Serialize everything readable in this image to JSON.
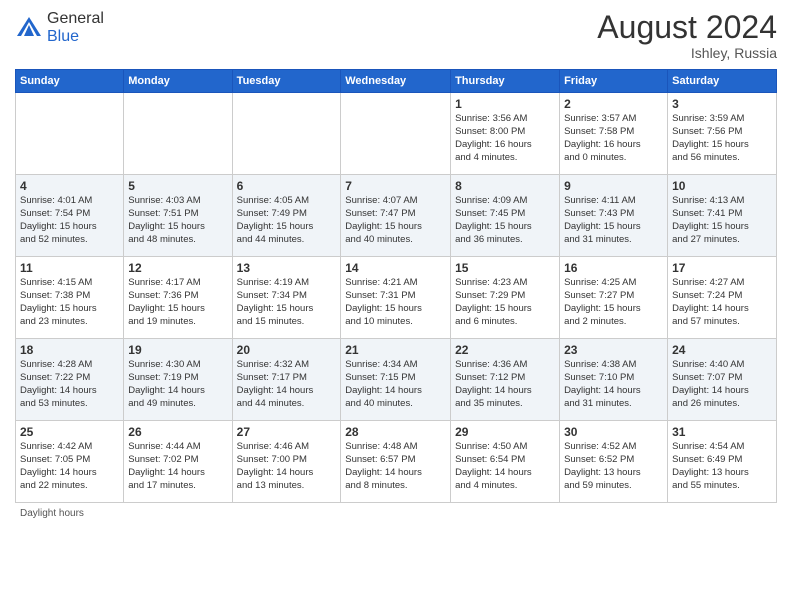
{
  "header": {
    "logo_general": "General",
    "logo_blue": "Blue",
    "month_year": "August 2024",
    "location": "Ishley, Russia"
  },
  "days_of_week": [
    "Sunday",
    "Monday",
    "Tuesday",
    "Wednesday",
    "Thursday",
    "Friday",
    "Saturday"
  ],
  "footer": {
    "daylight_hours_label": "Daylight hours"
  },
  "weeks": [
    [
      {
        "num": "",
        "info": ""
      },
      {
        "num": "",
        "info": ""
      },
      {
        "num": "",
        "info": ""
      },
      {
        "num": "",
        "info": ""
      },
      {
        "num": "1",
        "info": "Sunrise: 3:56 AM\nSunset: 8:00 PM\nDaylight: 16 hours\nand 4 minutes."
      },
      {
        "num": "2",
        "info": "Sunrise: 3:57 AM\nSunset: 7:58 PM\nDaylight: 16 hours\nand 0 minutes."
      },
      {
        "num": "3",
        "info": "Sunrise: 3:59 AM\nSunset: 7:56 PM\nDaylight: 15 hours\nand 56 minutes."
      }
    ],
    [
      {
        "num": "4",
        "info": "Sunrise: 4:01 AM\nSunset: 7:54 PM\nDaylight: 15 hours\nand 52 minutes."
      },
      {
        "num": "5",
        "info": "Sunrise: 4:03 AM\nSunset: 7:51 PM\nDaylight: 15 hours\nand 48 minutes."
      },
      {
        "num": "6",
        "info": "Sunrise: 4:05 AM\nSunset: 7:49 PM\nDaylight: 15 hours\nand 44 minutes."
      },
      {
        "num": "7",
        "info": "Sunrise: 4:07 AM\nSunset: 7:47 PM\nDaylight: 15 hours\nand 40 minutes."
      },
      {
        "num": "8",
        "info": "Sunrise: 4:09 AM\nSunset: 7:45 PM\nDaylight: 15 hours\nand 36 minutes."
      },
      {
        "num": "9",
        "info": "Sunrise: 4:11 AM\nSunset: 7:43 PM\nDaylight: 15 hours\nand 31 minutes."
      },
      {
        "num": "10",
        "info": "Sunrise: 4:13 AM\nSunset: 7:41 PM\nDaylight: 15 hours\nand 27 minutes."
      }
    ],
    [
      {
        "num": "11",
        "info": "Sunrise: 4:15 AM\nSunset: 7:38 PM\nDaylight: 15 hours\nand 23 minutes."
      },
      {
        "num": "12",
        "info": "Sunrise: 4:17 AM\nSunset: 7:36 PM\nDaylight: 15 hours\nand 19 minutes."
      },
      {
        "num": "13",
        "info": "Sunrise: 4:19 AM\nSunset: 7:34 PM\nDaylight: 15 hours\nand 15 minutes."
      },
      {
        "num": "14",
        "info": "Sunrise: 4:21 AM\nSunset: 7:31 PM\nDaylight: 15 hours\nand 10 minutes."
      },
      {
        "num": "15",
        "info": "Sunrise: 4:23 AM\nSunset: 7:29 PM\nDaylight: 15 hours\nand 6 minutes."
      },
      {
        "num": "16",
        "info": "Sunrise: 4:25 AM\nSunset: 7:27 PM\nDaylight: 15 hours\nand 2 minutes."
      },
      {
        "num": "17",
        "info": "Sunrise: 4:27 AM\nSunset: 7:24 PM\nDaylight: 14 hours\nand 57 minutes."
      }
    ],
    [
      {
        "num": "18",
        "info": "Sunrise: 4:28 AM\nSunset: 7:22 PM\nDaylight: 14 hours\nand 53 minutes."
      },
      {
        "num": "19",
        "info": "Sunrise: 4:30 AM\nSunset: 7:19 PM\nDaylight: 14 hours\nand 49 minutes."
      },
      {
        "num": "20",
        "info": "Sunrise: 4:32 AM\nSunset: 7:17 PM\nDaylight: 14 hours\nand 44 minutes."
      },
      {
        "num": "21",
        "info": "Sunrise: 4:34 AM\nSunset: 7:15 PM\nDaylight: 14 hours\nand 40 minutes."
      },
      {
        "num": "22",
        "info": "Sunrise: 4:36 AM\nSunset: 7:12 PM\nDaylight: 14 hours\nand 35 minutes."
      },
      {
        "num": "23",
        "info": "Sunrise: 4:38 AM\nSunset: 7:10 PM\nDaylight: 14 hours\nand 31 minutes."
      },
      {
        "num": "24",
        "info": "Sunrise: 4:40 AM\nSunset: 7:07 PM\nDaylight: 14 hours\nand 26 minutes."
      }
    ],
    [
      {
        "num": "25",
        "info": "Sunrise: 4:42 AM\nSunset: 7:05 PM\nDaylight: 14 hours\nand 22 minutes."
      },
      {
        "num": "26",
        "info": "Sunrise: 4:44 AM\nSunset: 7:02 PM\nDaylight: 14 hours\nand 17 minutes."
      },
      {
        "num": "27",
        "info": "Sunrise: 4:46 AM\nSunset: 7:00 PM\nDaylight: 14 hours\nand 13 minutes."
      },
      {
        "num": "28",
        "info": "Sunrise: 4:48 AM\nSunset: 6:57 PM\nDaylight: 14 hours\nand 8 minutes."
      },
      {
        "num": "29",
        "info": "Sunrise: 4:50 AM\nSunset: 6:54 PM\nDaylight: 14 hours\nand 4 minutes."
      },
      {
        "num": "30",
        "info": "Sunrise: 4:52 AM\nSunset: 6:52 PM\nDaylight: 13 hours\nand 59 minutes."
      },
      {
        "num": "31",
        "info": "Sunrise: 4:54 AM\nSunset: 6:49 PM\nDaylight: 13 hours\nand 55 minutes."
      }
    ]
  ]
}
